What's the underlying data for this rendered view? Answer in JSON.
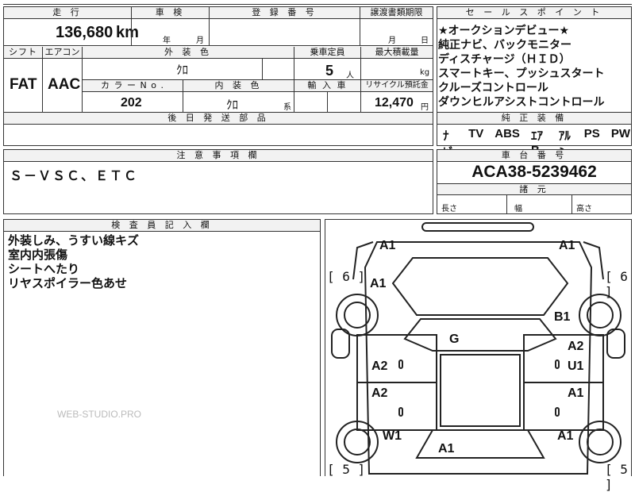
{
  "top": {
    "mileage_header": "走 行",
    "mileage_value": "136,680",
    "mileage_unit": "km",
    "inspection_header": "車 検",
    "inspection_year_unit": "年",
    "inspection_month_unit": "月",
    "registration_header": "登 録 番 号",
    "transfer_header": "譲渡書類期限",
    "transfer_month_unit": "月",
    "transfer_day_unit": "日"
  },
  "mid": {
    "shift_header": "シフト",
    "shift_value": "FAT",
    "ac_header": "エアコン",
    "ac_value": "AAC",
    "exterior_color_header": "外 装 色",
    "exterior_color_value": "ｸﾛ",
    "capacity_header": "乗車定員",
    "capacity_value": "5",
    "capacity_unit": "人",
    "max_load_header": "最大積載量",
    "max_load_unit": "kg",
    "color_no_header": "カ ラ ー N o .",
    "color_no_value": "202",
    "interior_color_header": "内 装 色",
    "interior_color_value": "ｸﾛ",
    "interior_color_suffix": "系",
    "import_header": "輸 入 車",
    "recycle_header": "リサイクル預託金",
    "recycle_value": "12,470",
    "recycle_unit": "円",
    "later_parts_header": "後 日 発 送 部 品"
  },
  "sales_points": {
    "header": "セ ー ル ス ポ イ ン ト",
    "items": [
      "★オークションデビュー★",
      "純正ナビ、バックモニター",
      "ディスチャージ（ＨＩＤ）",
      "スマートキー、プッシュスタート",
      "クルーズコントロール",
      "ダウンヒルアシストコントロール"
    ]
  },
  "equipment": {
    "header": "純 正 装 備",
    "items": [
      "ﾅﾋﾞ",
      "TV",
      "ABS",
      "ｴｱB",
      "ｱﾙﾐ",
      "PS",
      "PW"
    ]
  },
  "notes": {
    "header": "注 意 事 項 欄",
    "value": "Ｓ－ＶＳＣ、ＥＴＣ"
  },
  "chassis": {
    "header": "車 台 番 号",
    "value": "ACA38-5239462",
    "dims_header": "諸 元",
    "length_label": "長さ",
    "width_label": "幅",
    "height_label": "高さ"
  },
  "inspector": {
    "header": "検 査 員 記 入 欄",
    "lines": [
      "外装しみ、うすい線キズ",
      "室内内張傷",
      "シートへたり",
      "リヤスポイラー色あせ"
    ]
  },
  "watermark": "WEB-STUDIO.PRO",
  "diagram": {
    "tire_left_front": "6",
    "tire_right_front": "6",
    "tire_left_rear": "5",
    "tire_right_rear": "5",
    "marks": {
      "front_left": "A1",
      "front_right": "A1",
      "fender_left_front": "A1",
      "fender_right_front": "B1",
      "roof": "G",
      "door_right_front_a": "A2",
      "door_right_front_b": "U1",
      "door_left_front": "A2",
      "door_left_rear": "A2",
      "door_right_rear": "A1",
      "fender_left_rear": "W1",
      "fender_right_rear": "A1",
      "rear_center": "A1"
    }
  }
}
